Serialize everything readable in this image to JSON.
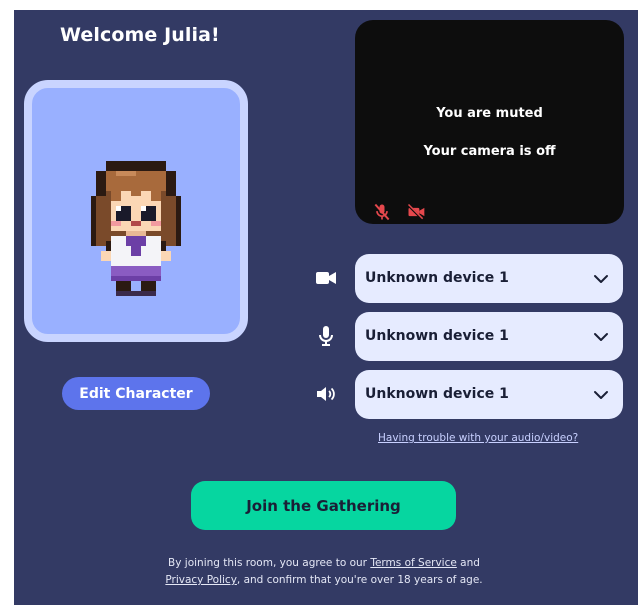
{
  "welcome": {
    "title": "Welcome Julia!"
  },
  "character": {
    "edit_label": "Edit Character"
  },
  "preview": {
    "muted_text": "You are muted",
    "camera_text": "Your camera is off",
    "mic_indicator_icon": "mic-off-icon",
    "camera_indicator_icon": "camera-off-icon",
    "indicator_color": "#e5484d"
  },
  "devices": {
    "camera": {
      "icon": "video-camera-icon",
      "value": "Unknown device 1"
    },
    "microphone": {
      "icon": "microphone-icon",
      "value": "Unknown device 1"
    },
    "speaker": {
      "icon": "speaker-icon",
      "value": "Unknown device 1"
    }
  },
  "trouble_link": "Having trouble with your audio/video?",
  "join_label": "Join the Gathering",
  "terms": {
    "prefix": "By joining this room, you agree to our ",
    "tos_link": "Terms of Service",
    "and": " and",
    "privacy_link": "Privacy Policy",
    "suffix": ", and confirm that you're over 18 years of age."
  },
  "colors": {
    "background": "#333a64",
    "accent_green": "#06d6a0",
    "accent_blue": "#5d74ec",
    "select_bg": "#e6ebff",
    "card_bg": "#99b0ff"
  }
}
